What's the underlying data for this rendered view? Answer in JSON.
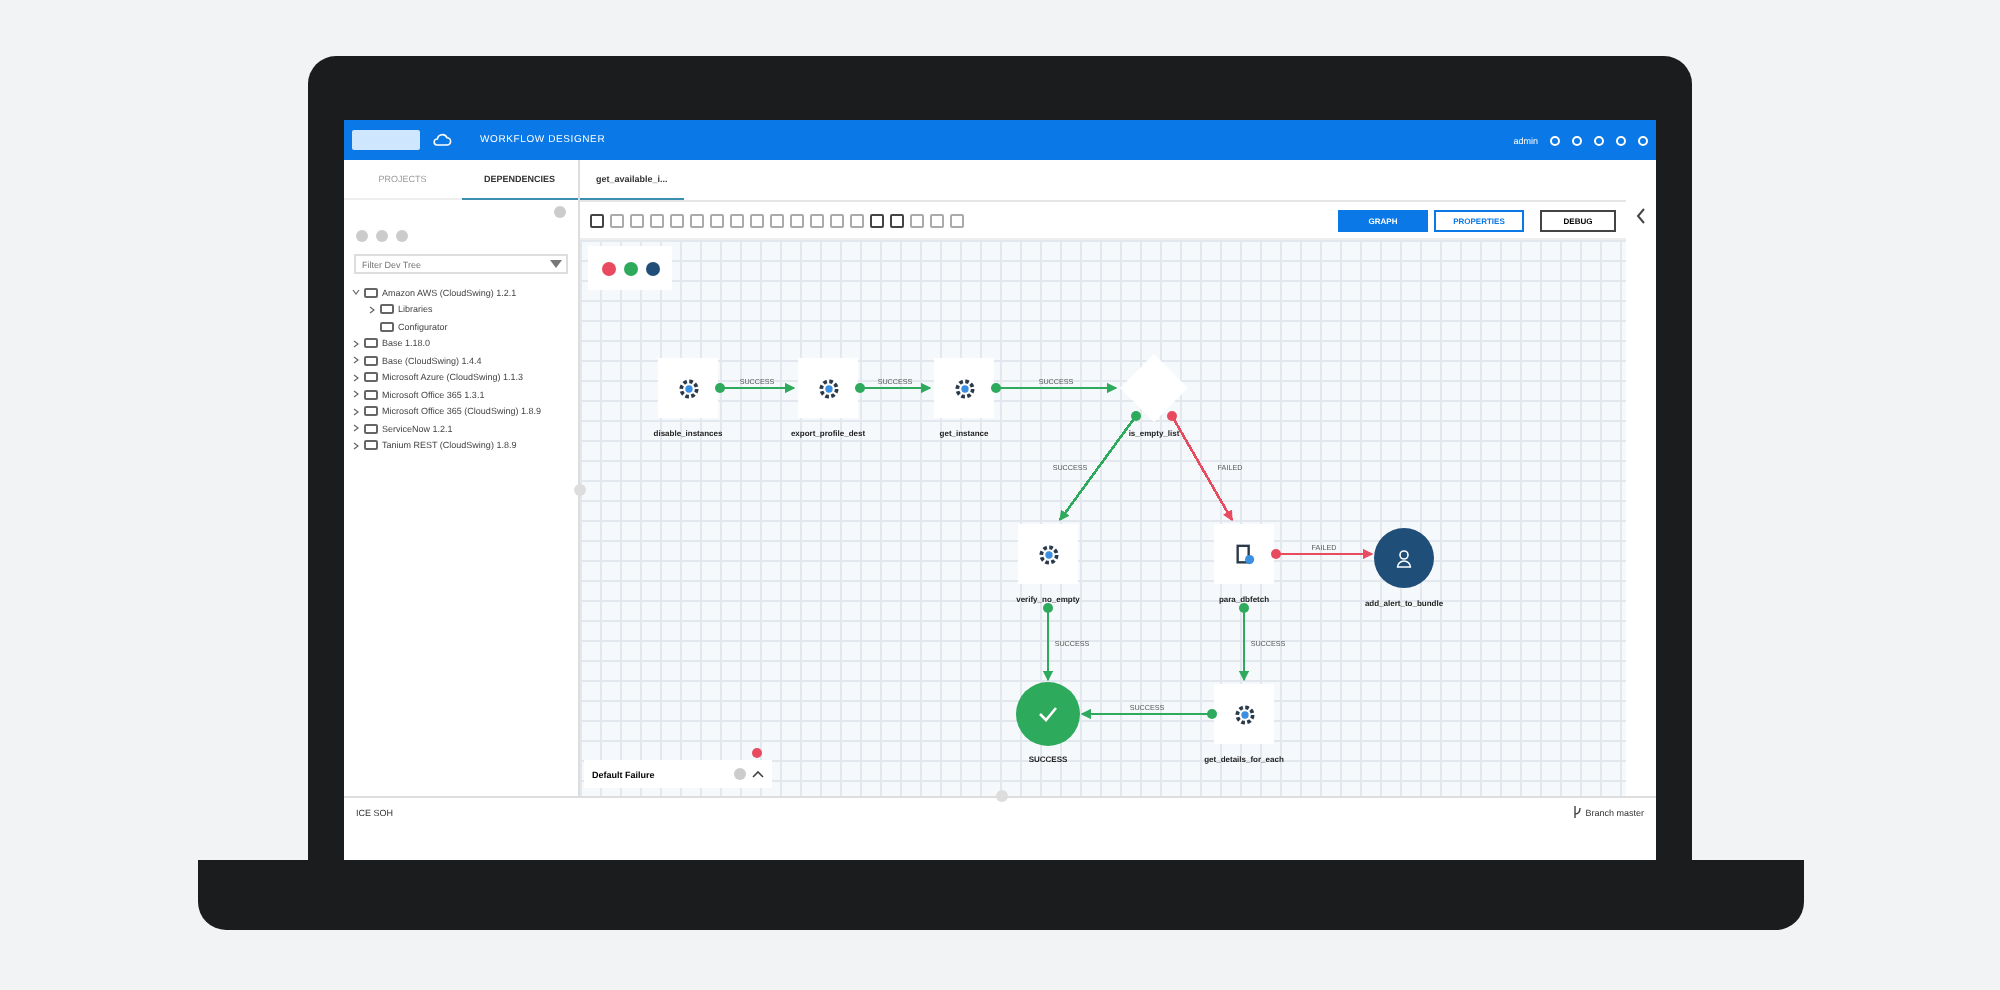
{
  "header": {
    "title": "WORKFLOW DESIGNER",
    "user": "admin"
  },
  "sidebar": {
    "tabs": [
      {
        "label": "PROJECTS",
        "selected": false
      },
      {
        "label": "DEPENDENCIES",
        "selected": true
      }
    ],
    "filter": {
      "placeholder": "Filter Dev Tree"
    },
    "tree": [
      {
        "label": "Amazon AWS (CloudSwing) 1.2.1",
        "kind": "branch",
        "expanded": true,
        "children": [
          {
            "label": "Libraries",
            "kind": "branch",
            "expanded": false
          },
          {
            "label": "Configurator",
            "kind": "leaf"
          }
        ]
      },
      {
        "label": "Base 1.18.0",
        "kind": "branch",
        "expanded": false
      },
      {
        "label": "Base (CloudSwing) 1.4.4",
        "kind": "branch",
        "expanded": false
      },
      {
        "label": "Microsoft Azure (CloudSwing) 1.1.3",
        "kind": "branch",
        "expanded": false
      },
      {
        "label": "Microsoft Office 365 1.3.1",
        "kind": "branch",
        "expanded": false
      },
      {
        "label": "Microsoft Office 365 (CloudSwing) 1.8.9",
        "kind": "branch",
        "expanded": false
      },
      {
        "label": "ServiceNow 1.2.1",
        "kind": "branch",
        "expanded": false
      },
      {
        "label": "Tanium REST (CloudSwing) 1.8.9",
        "kind": "branch",
        "expanded": false
      }
    ]
  },
  "editor_tabs": [
    {
      "label": "get_available_i...",
      "selected": true
    }
  ],
  "view_buttons": [
    {
      "label": "GRAPH",
      "selected": true
    },
    {
      "label": "PROPERTIES",
      "selected": false
    }
  ],
  "debug_button": "DEBUG",
  "legend": [
    {
      "color": "#e84a5f"
    },
    {
      "color": "#2eaa5c"
    },
    {
      "color": "#1f4e79"
    }
  ],
  "nodes": [
    {
      "label": "disable_instances",
      "kind": "task"
    },
    {
      "label": "export_profile_dest",
      "kind": "task"
    },
    {
      "label": "get_instance",
      "kind": "task"
    },
    {
      "label": "is_empty_list",
      "kind": "decision"
    },
    {
      "label": "verify_no_empty",
      "kind": "task"
    },
    {
      "label": "para_dbfetch",
      "kind": "script"
    },
    {
      "label": "add_alert_to_bundle",
      "kind": "user"
    },
    {
      "label": "SUCCESS",
      "kind": "end"
    },
    {
      "label": "get_details_for_each",
      "kind": "loop"
    }
  ],
  "edges": [
    {
      "label": "SUCCESS",
      "color": "#2eaa5c"
    },
    {
      "label": "SUCCESS",
      "color": "#2eaa5c"
    },
    {
      "label": "SUCCESS",
      "color": "#2eaa5c"
    },
    {
      "label": "SUCCESS",
      "color": "#2eaa5c"
    },
    {
      "label": "FAILED",
      "color": "#e84a5f"
    },
    {
      "label": "FAILED",
      "color": "#e84a5f"
    },
    {
      "label": "SUCCESS",
      "color": "#2eaa5c"
    },
    {
      "label": "SUCCESS",
      "color": "#2eaa5c"
    },
    {
      "label": "SUCCESS",
      "color": "#2eaa5c"
    }
  ],
  "failure_panel": {
    "title": "Default Failure"
  },
  "status_bar": {
    "left": "ICE SOH",
    "right": "Branch master"
  }
}
